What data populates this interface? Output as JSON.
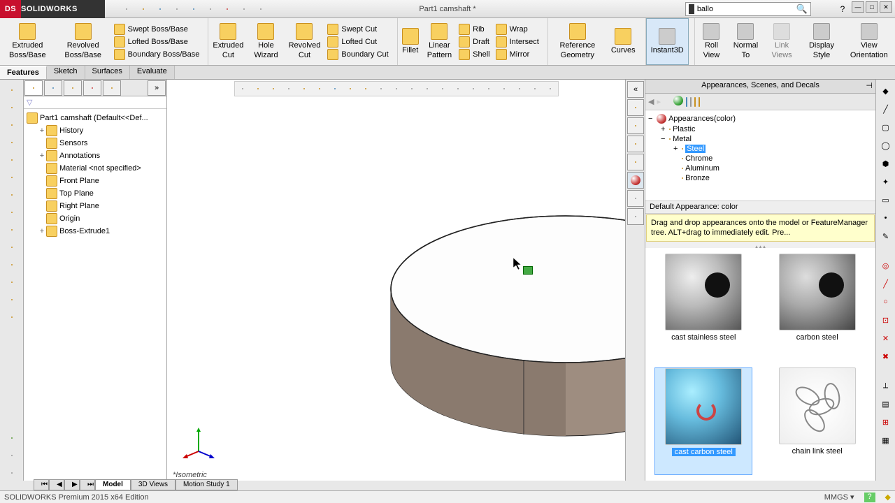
{
  "title": "Part1 camshaft *",
  "search": {
    "value": "ballo"
  },
  "logo_text": "SOLIDWORKS",
  "ribbon": {
    "extruded_boss": "Extruded Boss/Base",
    "revolved_boss": "Revolved Boss/Base",
    "swept_boss": "Swept Boss/Base",
    "lofted_boss": "Lofted Boss/Base",
    "boundary_boss": "Boundary Boss/Base",
    "extruded_cut": "Extruded Cut",
    "hole_wizard": "Hole Wizard",
    "revolved_cut": "Revolved Cut",
    "swept_cut": "Swept Cut",
    "lofted_cut": "Lofted Cut",
    "boundary_cut": "Boundary Cut",
    "fillet": "Fillet",
    "linear_pattern": "Linear Pattern",
    "draft": "Draft",
    "rib": "Rib",
    "shell": "Shell",
    "wrap": "Wrap",
    "intersect": "Intersect",
    "mirror": "Mirror",
    "reference_geometry": "Reference Geometry",
    "curves": "Curves",
    "instant3d": "Instant3D",
    "roll_view": "Roll View",
    "normal_to": "Normal To",
    "link_views": "Link Views",
    "display_style": "Display Style",
    "view_orientation": "View Orientation"
  },
  "feature_tabs": [
    "Features",
    "Sketch",
    "Surfaces",
    "Evaluate"
  ],
  "tree": {
    "root": "Part1 camshaft  (Default<<Def...",
    "nodes": [
      "History",
      "Sensors",
      "Annotations",
      "Material <not specified>",
      "Front Plane",
      "Top Plane",
      "Right Plane",
      "Origin",
      "Boss-Extrude1"
    ]
  },
  "viewport": {
    "view_label": "*Isometric"
  },
  "appearance": {
    "title": "Appearances, Scenes, and Decals",
    "root": "Appearances(color)",
    "plastic": "Plastic",
    "metal": "Metal",
    "steel": "Steel",
    "chrome": "Chrome",
    "aluminum": "Aluminum",
    "bronze": "Bronze",
    "default_label": "Default Appearance: color",
    "hint": "Drag and drop appearances onto the model or FeatureManager tree.  ALT+drag to immediately edit.  Pre...",
    "thumbs": [
      "cast stainless steel",
      "carbon steel",
      "cast carbon steel",
      "chain link steel"
    ]
  },
  "bottom_tabs": [
    "Model",
    "3D Views",
    "Motion Study 1"
  ],
  "status": {
    "edition": "SOLIDWORKS Premium 2015 x64 Edition",
    "units": "MMGS"
  }
}
